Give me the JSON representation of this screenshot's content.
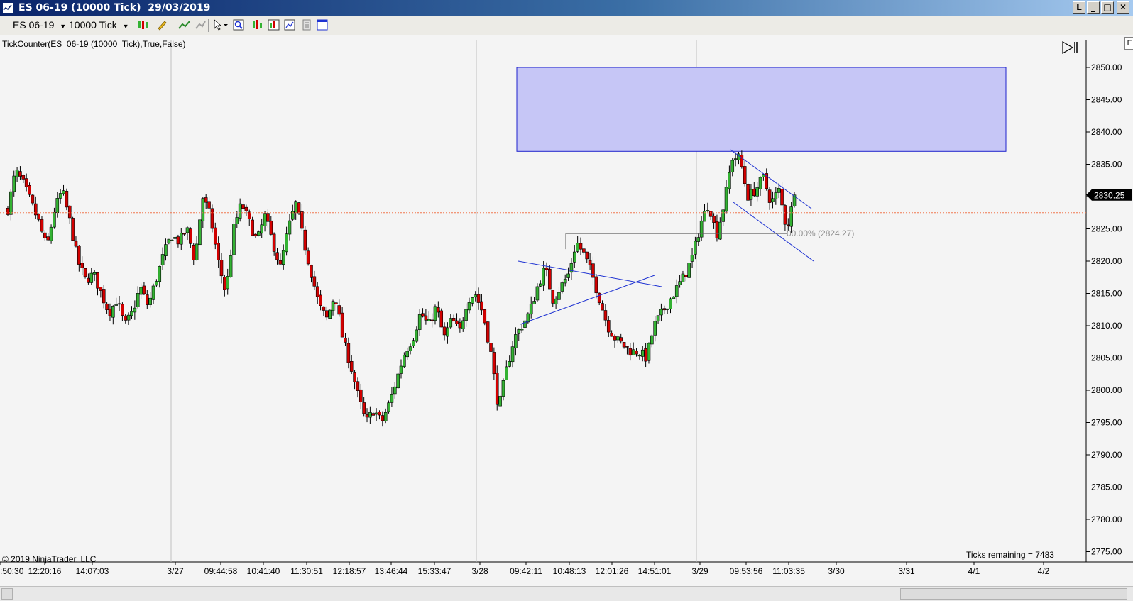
{
  "window": {
    "title": "ES 06-19 (10000 Tick)  29/03/2019",
    "buttons": [
      "L",
      "_",
      "□",
      "✕"
    ]
  },
  "toolbar": {
    "instrument": "ES 06-19",
    "interval": "10000 Tick",
    "icons": [
      "bar-type-icon",
      "pencil-draw-icon",
      "indicator-icon",
      "strategy-icon",
      "cursor-icon",
      "zoom-icon",
      "data-box-icon",
      "chart-properties-icon",
      "copy-icon",
      "window-icon"
    ]
  },
  "chart": {
    "indicator_label": "TickCounter(ES  06-19 (10000  Tick),True,False)",
    "copyright": "© 2019 NinjaTrader, LLC",
    "ticks_remaining": "Ticks remaining = 7483",
    "current_price": "2830.25",
    "fib_label": "00.00% (2824.27)",
    "corner_label": "F",
    "colors": {
      "up_candle": "#34b233",
      "down_candle": "#d20000",
      "zone": "#c6c6f6",
      "zone_border": "#1e22cc",
      "trend_line": "#1e32d2",
      "price_line": "#f07850",
      "badge_bg": "#000000"
    }
  },
  "chart_data": {
    "type": "candlestick",
    "y_ticks": [
      "2850.00",
      "2845.00",
      "2840.00",
      "2835.00",
      "2830.00",
      "2825.00",
      "2820.00",
      "2815.00",
      "2810.00",
      "2805.00",
      "2800.00",
      "2795.00",
      "2790.00",
      "2785.00",
      "2780.00",
      "2775.00"
    ],
    "ylim": [
      2774,
      2852
    ],
    "x_ticks": [
      ":50:30",
      "12:20:16",
      "14:07:03",
      "3/27",
      "09:44:58",
      "10:41:40",
      "11:30:51",
      "12:18:57",
      "13:46:44",
      "15:33:47",
      "3/28",
      "09:42:11",
      "10:48:13",
      "12:01:26",
      "14:51:01",
      "3/29",
      "09:53:56",
      "11:03:35",
      "3/30",
      "3/31",
      "4/1",
      "4/2"
    ],
    "day_separators": [
      "3/27",
      "3/28",
      "3/29"
    ],
    "close_path": [
      2828,
      2834,
      2832,
      2829,
      2826,
      2822,
      2828,
      2831,
      2826,
      2820,
      2817,
      2818,
      2815,
      2812,
      2814,
      2810,
      2812,
      2816,
      2813,
      2817,
      2821,
      2824,
      2823,
      2825,
      2820,
      2830,
      2827,
      2820,
      2815,
      2825,
      2829,
      2826,
      2823,
      2827,
      2823,
      2819,
      2825,
      2829,
      2823,
      2818,
      2813,
      2811,
      2815,
      2808,
      2804,
      2799,
      2795,
      2797,
      2795,
      2798,
      2802,
      2806,
      2808,
      2812,
      2810,
      2813,
      2808,
      2811,
      2809,
      2814,
      2815,
      2812,
      2806,
      2797,
      2803,
      2808,
      2810,
      2812,
      2816,
      2819,
      2814,
      2816,
      2818,
      2823,
      2821,
      2818,
      2814,
      2810,
      2808,
      2807,
      2806,
      2806,
      2805,
      2810,
      2812,
      2814,
      2816,
      2818,
      2821,
      2826,
      2829,
      2824,
      2829,
      2836,
      2836,
      2830,
      2831,
      2833,
      2829,
      2831,
      2825,
      2830
    ],
    "current_price": 2830.25,
    "zone": {
      "top": 2850,
      "bottom": 2837
    },
    "fib_level": 2824.27
  }
}
